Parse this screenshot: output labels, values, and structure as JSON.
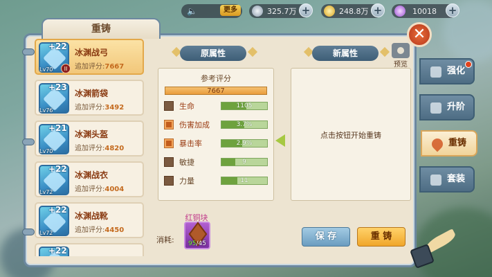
{
  "topbar": {
    "more_label": "更多",
    "currencies": [
      {
        "icon": "silver-coin-icon",
        "value": "325.7万"
      },
      {
        "icon": "gold-ingot-icon",
        "value": "248.8万"
      },
      {
        "icon": "purple-gem-icon",
        "value": "10018"
      }
    ],
    "plus": "+"
  },
  "panel": {
    "title": "重铸",
    "close": "✕"
  },
  "equipment": [
    {
      "plus": "+22",
      "level": "Lv70",
      "name": "冰渊战弓",
      "score_label": "追加评分:",
      "score": "7667",
      "selected": true,
      "badge": "II"
    },
    {
      "plus": "+23",
      "level": "Lv76",
      "name": "冰渊箭袋",
      "score_label": "追加评分:",
      "score": "3492",
      "selected": false
    },
    {
      "plus": "+21",
      "level": "Lv70",
      "name": "冰渊头盔",
      "score_label": "追加评分:",
      "score": "4820",
      "selected": false
    },
    {
      "plus": "+22",
      "level": "Lv72",
      "name": "冰渊战衣",
      "score_label": "追加评分:",
      "score": "4004",
      "selected": false
    },
    {
      "plus": "+22",
      "level": "Lv72",
      "name": "冰渊战靴",
      "score_label": "追加评分:",
      "score": "4450",
      "selected": false
    },
    {
      "plus": "+22",
      "level": "",
      "name": "",
      "score_label": "",
      "score": "",
      "selected": false
    }
  ],
  "original": {
    "section_title": "原属性",
    "ref_title": "参考评分",
    "ref_score": "7667",
    "attributes": [
      {
        "name": "生命",
        "value": "1105",
        "fill": 0.55,
        "locked": false,
        "highlight": true
      },
      {
        "name": "伤害加成",
        "value": "3.7%",
        "fill": 0.5,
        "locked": true,
        "highlight": true
      },
      {
        "name": "暴击率",
        "value": "2.9%",
        "fill": 0.45,
        "locked": true,
        "highlight": true
      },
      {
        "name": "敏捷",
        "value": "9",
        "fill": 0.3,
        "locked": false,
        "highlight": false
      },
      {
        "name": "力量",
        "value": "11",
        "fill": 0.35,
        "locked": false,
        "highlight": false
      }
    ]
  },
  "new_attrs": {
    "section_title": "新属性",
    "hint": "点击按钮开始重铸",
    "preview_label": "预览"
  },
  "cost": {
    "label": "消耗:",
    "item_name": "红铜块",
    "have": "95",
    "need": "/45"
  },
  "buttons": {
    "save": "保 存",
    "recast": "重 铸"
  },
  "side_tabs": [
    {
      "label": "强化",
      "icon": "hammer-icon",
      "active": false,
      "dot": true
    },
    {
      "label": "升阶",
      "icon": "upgrade-icon",
      "active": false,
      "dot": false
    },
    {
      "label": "重铸",
      "icon": "flame-icon",
      "active": true,
      "dot": false
    },
    {
      "label": "套装",
      "icon": "set-icon",
      "active": false,
      "dot": false
    }
  ]
}
